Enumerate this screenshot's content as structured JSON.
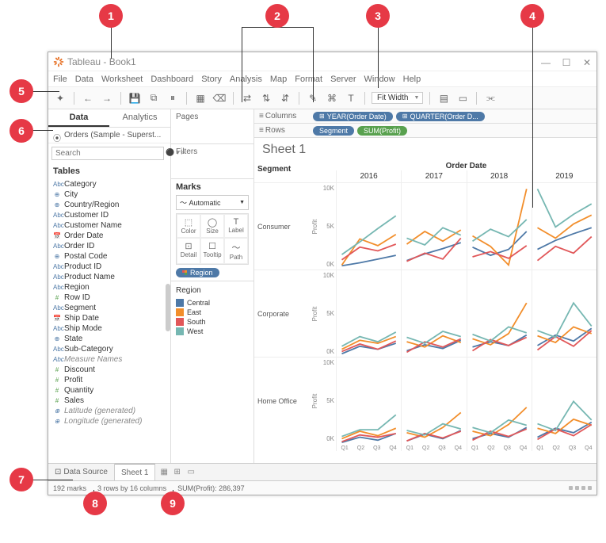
{
  "callouts": {
    "1": "1",
    "2": "2",
    "3": "3",
    "4": "4",
    "5": "5",
    "6": "6",
    "7": "7",
    "8": "8",
    "9": "9"
  },
  "window": {
    "title": "Tableau - Book1"
  },
  "menu": [
    "File",
    "Data",
    "Worksheet",
    "Dashboard",
    "Story",
    "Analysis",
    "Map",
    "Format",
    "Server",
    "Window",
    "Help"
  ],
  "toolbar": {
    "fit": "Fit Width"
  },
  "data_pane": {
    "tabs": {
      "data": "Data",
      "analytics": "Analytics"
    },
    "datasource": "Orders (Sample - Superst...",
    "search_placeholder": "Search",
    "tables_header": "Tables",
    "fields": [
      {
        "icon": "Abc",
        "label": "Category",
        "t": "abc"
      },
      {
        "icon": "⊕",
        "label": "City",
        "t": "geo"
      },
      {
        "icon": "⊕",
        "label": "Country/Region",
        "t": "geo"
      },
      {
        "icon": "Abc",
        "label": "Customer ID",
        "t": "abc"
      },
      {
        "icon": "Abc",
        "label": "Customer Name",
        "t": "abc"
      },
      {
        "icon": "📅",
        "label": "Order Date",
        "t": "date"
      },
      {
        "icon": "Abc",
        "label": "Order ID",
        "t": "abc"
      },
      {
        "icon": "⊕",
        "label": "Postal Code",
        "t": "geo"
      },
      {
        "icon": "Abc",
        "label": "Product ID",
        "t": "abc"
      },
      {
        "icon": "Abc",
        "label": "Product Name",
        "t": "abc"
      },
      {
        "icon": "Abc",
        "label": "Region",
        "t": "abc"
      },
      {
        "icon": "#",
        "label": "Row ID",
        "t": "num"
      },
      {
        "icon": "Abc",
        "label": "Segment",
        "t": "abc"
      },
      {
        "icon": "📅",
        "label": "Ship Date",
        "t": "date"
      },
      {
        "icon": "Abc",
        "label": "Ship Mode",
        "t": "abc"
      },
      {
        "icon": "⊕",
        "label": "State",
        "t": "geo"
      },
      {
        "icon": "Abc",
        "label": "Sub-Category",
        "t": "abc"
      },
      {
        "icon": "Abc",
        "label": "Measure Names",
        "t": "abc",
        "italic": true
      },
      {
        "icon": "#",
        "label": "Discount",
        "t": "num"
      },
      {
        "icon": "#",
        "label": "Profit",
        "t": "num"
      },
      {
        "icon": "#",
        "label": "Quantity",
        "t": "num"
      },
      {
        "icon": "#",
        "label": "Sales",
        "t": "num"
      },
      {
        "icon": "⊕",
        "label": "Latitude (generated)",
        "t": "geo",
        "italic": true
      },
      {
        "icon": "⊕",
        "label": "Longitude (generated)",
        "t": "geo",
        "italic": true
      }
    ]
  },
  "shelves": {
    "pages": "Pages",
    "filters": "Filters",
    "marks": "Marks",
    "mark_type": "Automatic",
    "mark_cells": [
      "Color",
      "Size",
      "Label",
      "Detail",
      "Tooltip",
      "Path"
    ],
    "mark_pill": "Region",
    "legend_title": "Region",
    "legend_items": [
      {
        "label": "Central",
        "color": "#4e79a7"
      },
      {
        "label": "East",
        "color": "#f28e2b"
      },
      {
        "label": "South",
        "color": "#e15759"
      },
      {
        "label": "West",
        "color": "#76b7b2"
      }
    ]
  },
  "viz": {
    "columns_label": "Columns",
    "rows_label": "Rows",
    "col_pills": [
      {
        "label": "YEAR(Order Date)",
        "t": "dim"
      },
      {
        "label": "QUARTER(Order D...",
        "t": "dim"
      }
    ],
    "row_pills": [
      {
        "label": "Segment",
        "t": "dim"
      },
      {
        "label": "SUM(Profit)",
        "t": "meas"
      }
    ],
    "sheet_title": "Sheet 1",
    "segment_header": "Segment",
    "order_date_header": "Order Date",
    "years": [
      "2016",
      "2017",
      "2018",
      "2019"
    ],
    "segments": [
      "Consumer",
      "Corporate",
      "Home Office"
    ],
    "yaxis_label": "Profit",
    "yticks": [
      "10K",
      "5K",
      "0K"
    ],
    "xticks": [
      "Q1",
      "Q2",
      "Q3",
      "Q4"
    ]
  },
  "bottom": {
    "datasource_tab": "Data Source",
    "sheet_tab": "Sheet 1"
  },
  "status": {
    "marks": "192 marks",
    "dims": "3 rows by 16 columns",
    "sum": "SUM(Profit): 286,397"
  },
  "chart_data": {
    "type": "line",
    "facets": {
      "rows": [
        "Consumer",
        "Corporate",
        "Home Office"
      ],
      "cols": [
        "2016",
        "2017",
        "2018",
        "2019"
      ]
    },
    "x": [
      "Q1",
      "Q2",
      "Q3",
      "Q4"
    ],
    "ylabel": "Profit",
    "ylim": [
      0,
      11000
    ],
    "series_colors": {
      "Central": "#4e79a7",
      "East": "#f28e2b",
      "South": "#e15759",
      "West": "#76b7b2"
    },
    "values": {
      "Consumer": {
        "2016": {
          "Central": [
            500,
            900,
            1400,
            1900
          ],
          "East": [
            600,
            4100,
            3200,
            4700
          ],
          "South": [
            1300,
            3000,
            2500,
            3400
          ],
          "West": [
            2000,
            3700,
            5500,
            7200
          ]
        },
        "2017": {
          "Central": [
            1200,
            2100,
            2800,
            3600
          ],
          "East": [
            3400,
            5100,
            3800,
            5300
          ],
          "South": [
            1100,
            2200,
            1400,
            4200
          ],
          "West": [
            4200,
            3300,
            5600,
            4600
          ]
        },
        "2018": {
          "Central": [
            3000,
            1900,
            2700,
            5100
          ],
          "East": [
            4500,
            3100,
            600,
            10800
          ],
          "South": [
            1700,
            2400,
            1500,
            3200
          ],
          "West": [
            3800,
            5400,
            4400,
            6700
          ]
        },
        "2019": {
          "Central": [
            2700,
            3900,
            4800,
            5600
          ],
          "East": [
            5600,
            4200,
            6100,
            7300
          ],
          "South": [
            1200,
            3100,
            2200,
            4400
          ],
          "West": [
            10800,
            5700,
            7400,
            8800
          ]
        }
      },
      "Corporate": {
        "2016": {
          "Central": [
            400,
            1400,
            1000,
            1800
          ],
          "East": [
            1000,
            2200,
            1800,
            2700
          ],
          "South": [
            700,
            1700,
            1000,
            2100
          ],
          "West": [
            1400,
            2700,
            2000,
            3300
          ]
        },
        "2017": {
          "Central": [
            800,
            1600,
            1100,
            2200
          ],
          "East": [
            2000,
            1300,
            2800,
            1900
          ],
          "South": [
            600,
            2000,
            1300,
            2400
          ],
          "West": [
            2600,
            1800,
            3400,
            2700
          ]
        },
        "2018": {
          "Central": [
            1300,
            2000,
            1500,
            2900
          ],
          "East": [
            2400,
            1600,
            3100,
            7200
          ],
          "South": [
            800,
            2300,
            1500,
            2600
          ],
          "West": [
            3000,
            2100,
            4000,
            3200
          ]
        },
        "2019": {
          "Central": [
            1500,
            2900,
            2100,
            3800
          ],
          "East": [
            2800,
            1900,
            4000,
            3100
          ],
          "South": [
            900,
            2700,
            1400,
            3500
          ],
          "West": [
            3500,
            2600,
            7200,
            4100
          ]
        }
      },
      "Home Office": {
        "2016": {
          "Central": [
            200,
            900,
            500,
            1400
          ],
          "East": [
            700,
            1700,
            1100,
            2100
          ],
          "South": [
            300,
            1200,
            900,
            1400
          ],
          "West": [
            1000,
            1900,
            1900,
            3900
          ]
        },
        "2017": {
          "Central": [
            400,
            1300,
            700,
            1800
          ],
          "East": [
            1500,
            900,
            2200,
            4200
          ],
          "South": [
            400,
            1400,
            800,
            1700
          ],
          "West": [
            1800,
            1200,
            2700,
            2000
          ]
        },
        "2018": {
          "Central": [
            700,
            1400,
            900,
            2200
          ],
          "East": [
            1700,
            1100,
            2600,
            4900
          ],
          "South": [
            500,
            1700,
            1000,
            2000
          ],
          "West": [
            2200,
            1500,
            3200,
            2500
          ]
        },
        "2019": {
          "Central": [
            900,
            2100,
            1500,
            2900
          ],
          "East": [
            2100,
            1400,
            3300,
            2500
          ],
          "South": [
            600,
            2000,
            1100,
            2600
          ],
          "West": [
            2700,
            1800,
            5700,
            3200
          ]
        }
      }
    }
  }
}
